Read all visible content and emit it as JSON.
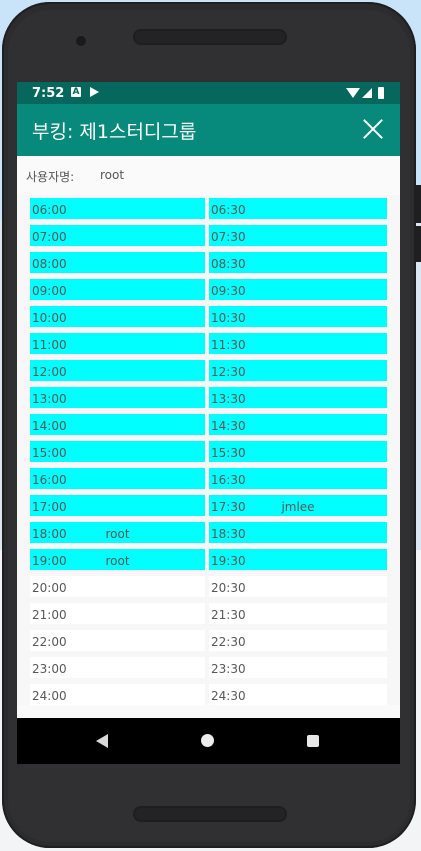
{
  "statusbar": {
    "time": "7:52",
    "notification_a": "A"
  },
  "appbar": {
    "title": "부킹: 제1스터디그룹"
  },
  "user": {
    "label": "사용자명:",
    "value": "root"
  },
  "schedule": {
    "left": [
      {
        "time": "06:00",
        "user": "",
        "booked": true
      },
      {
        "time": "07:00",
        "user": "",
        "booked": true
      },
      {
        "time": "08:00",
        "user": "",
        "booked": true
      },
      {
        "time": "09:00",
        "user": "",
        "booked": true
      },
      {
        "time": "10:00",
        "user": "",
        "booked": true
      },
      {
        "time": "11:00",
        "user": "",
        "booked": true
      },
      {
        "time": "12:00",
        "user": "",
        "booked": true
      },
      {
        "time": "13:00",
        "user": "",
        "booked": true
      },
      {
        "time": "14:00",
        "user": "",
        "booked": true
      },
      {
        "time": "15:00",
        "user": "",
        "booked": true
      },
      {
        "time": "16:00",
        "user": "",
        "booked": true
      },
      {
        "time": "17:00",
        "user": "",
        "booked": true
      },
      {
        "time": "18:00",
        "user": "root",
        "booked": true
      },
      {
        "time": "19:00",
        "user": "root",
        "booked": true
      },
      {
        "time": "20:00",
        "user": "",
        "booked": false
      },
      {
        "time": "21:00",
        "user": "",
        "booked": false
      },
      {
        "time": "22:00",
        "user": "",
        "booked": false
      },
      {
        "time": "23:00",
        "user": "",
        "booked": false
      },
      {
        "time": "24:00",
        "user": "",
        "booked": false
      }
    ],
    "right": [
      {
        "time": "06:30",
        "user": "",
        "booked": true
      },
      {
        "time": "07:30",
        "user": "",
        "booked": true
      },
      {
        "time": "08:30",
        "user": "",
        "booked": true
      },
      {
        "time": "09:30",
        "user": "",
        "booked": true
      },
      {
        "time": "10:30",
        "user": "",
        "booked": true
      },
      {
        "time": "11:30",
        "user": "",
        "booked": true
      },
      {
        "time": "12:30",
        "user": "",
        "booked": true
      },
      {
        "time": "13:30",
        "user": "",
        "booked": true
      },
      {
        "time": "14:30",
        "user": "",
        "booked": true
      },
      {
        "time": "15:30",
        "user": "",
        "booked": true
      },
      {
        "time": "16:30",
        "user": "",
        "booked": true
      },
      {
        "time": "17:30",
        "user": "jmlee",
        "booked": true
      },
      {
        "time": "18:30",
        "user": "",
        "booked": true
      },
      {
        "time": "19:30",
        "user": "",
        "booked": true
      },
      {
        "time": "20:30",
        "user": "",
        "booked": false
      },
      {
        "time": "21:30",
        "user": "",
        "booked": false
      },
      {
        "time": "22:30",
        "user": "",
        "booked": false
      },
      {
        "time": "23:30",
        "user": "",
        "booked": false
      },
      {
        "time": "24:30",
        "user": "",
        "booked": false
      }
    ]
  },
  "colors": {
    "booked": "#00ffff",
    "free": "#ffffff",
    "appbar": "#07897b",
    "statusbar": "#06675d"
  },
  "navbar": {
    "back_icon": "back-icon",
    "home_icon": "home-icon",
    "recents_icon": "recents-icon"
  }
}
